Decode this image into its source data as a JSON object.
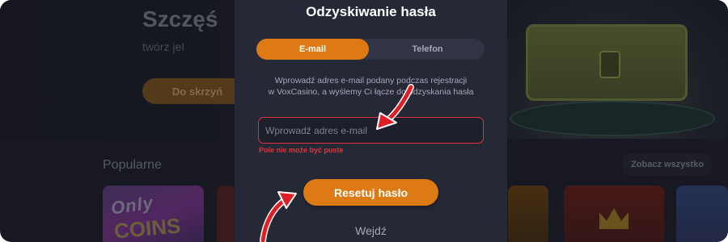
{
  "background": {
    "hero_title": "Szczęś",
    "hero_subtitle": "twórz jeI",
    "hero_button": "Do skrzyń",
    "section_title": "Popularne",
    "see_all_label": "Zobacz wszystko",
    "game_tile_1_line1": "Only",
    "game_tile_1_line2": "COINS"
  },
  "modal": {
    "title": "Odzyskiwanie hasła",
    "tabs": [
      {
        "label": "E-mail",
        "active": true
      },
      {
        "label": "Telefon",
        "active": false
      }
    ],
    "description_line1": "Wprowadź adres e-mail podany podczas rejestracji",
    "description_line2": "w VoxCasino, a wyślemy Ci łącze do odzyskania hasła",
    "email_placeholder": "Wprowadź adres e-mail",
    "email_value": "",
    "error_text": "Pole nie może być puste",
    "reset_button": "Resetuj hasło",
    "login_link": "Wejdź"
  },
  "colors": {
    "accent": "#de7a14",
    "error": "#e0343c",
    "arrow": "#e01e26",
    "modal_bg": "#252835",
    "page_bg": "#1b1d28"
  }
}
